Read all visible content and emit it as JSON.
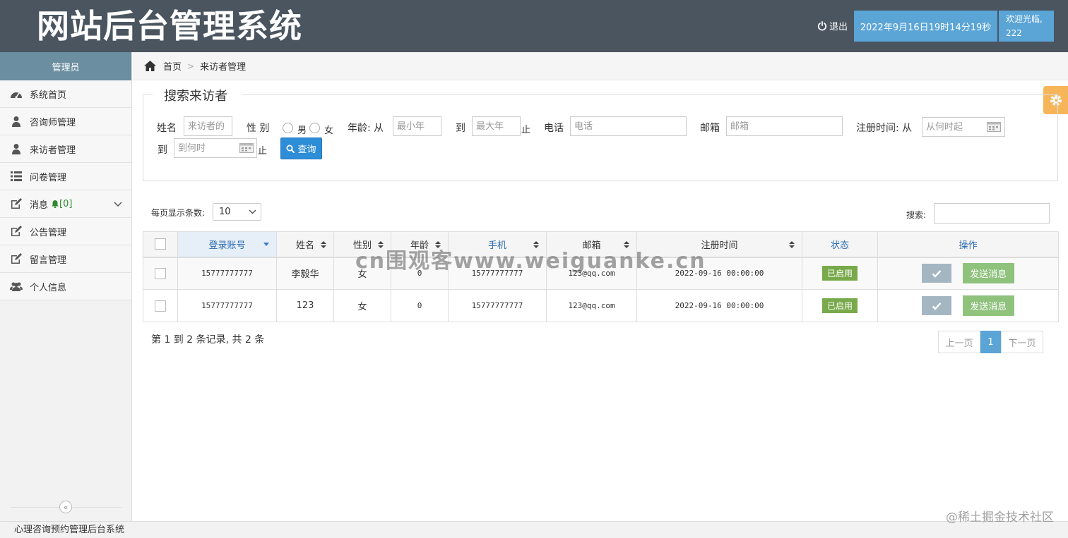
{
  "header": {
    "title": "网站后台管理系统",
    "logout_label": "退出",
    "datetime": "2022年9月16日19时14分19秒",
    "welcome_line1": "欢迎光临,",
    "welcome_line2": "222"
  },
  "sidebar": {
    "heading": "管理员",
    "items": [
      {
        "label": "系统首页",
        "icon": "dashboard-icon"
      },
      {
        "label": "咨询师管理",
        "icon": "user-icon"
      },
      {
        "label": "来访者管理",
        "icon": "user-icon"
      },
      {
        "label": "问卷管理",
        "icon": "list-icon"
      },
      {
        "label": "消息",
        "icon": "edit-icon",
        "count": "[0]"
      },
      {
        "label": "公告管理",
        "icon": "edit-icon"
      },
      {
        "label": "留言管理",
        "icon": "edit-icon"
      },
      {
        "label": "个人信息",
        "icon": "users-icon"
      }
    ],
    "collapse_glyph": "«"
  },
  "breadcrumb": {
    "home": "首页",
    "current": "来访者管理",
    "separator": ">"
  },
  "search": {
    "legend": "搜索来访者",
    "name_label": "姓名",
    "name_placeholder": "来访者的",
    "gender_label": "性 别",
    "gender_male": "男",
    "gender_female": "女",
    "age_label": "年龄: 从",
    "age_min_placeholder": "最小年",
    "age_to": "到",
    "age_max_placeholder": "最大年",
    "age_end": "止",
    "phone_label": "电话",
    "phone_placeholder": "电话",
    "email_label": "邮箱",
    "email_placeholder": "邮箱",
    "regtime_label": "注册时间: 从",
    "regtime_from_placeholder": "从何时起",
    "regtime_to": "到",
    "regtime_to_placeholder": "到何时",
    "regtime_end": "止",
    "query_label": "查询"
  },
  "table_controls": {
    "page_size_label": "每页显示条数:",
    "page_size_value": "10",
    "search_label": "搜索:"
  },
  "table": {
    "columns": [
      "登录账号",
      "姓名",
      "性别",
      "年龄",
      "手机",
      "邮箱",
      "注册时间",
      "状态",
      "操作"
    ],
    "rows": [
      {
        "account": "15777777777",
        "name": "李毅华",
        "gender": "女",
        "age": "0",
        "phone": "15777777777",
        "email": "123@qq.com",
        "regtime": "2022-09-16 00:00:00",
        "status": "已启用",
        "action": "发送消息"
      },
      {
        "account": "15777777777",
        "name": "123",
        "gender": "女",
        "age": "0",
        "phone": "15777777777",
        "email": "123@qq.com",
        "regtime": "2022-09-16 00:00:00",
        "status": "已启用",
        "action": "发送消息"
      }
    ]
  },
  "pagination": {
    "info": "第 1 到 2 条记录, 共 2 条",
    "prev": "上一页",
    "current": "1",
    "next": "下一页"
  },
  "watermark": "cn围观客www.weiguanke.cn",
  "footer": {
    "text": "心理咨询预约管理后台系统",
    "watermark": "@稀土掘金技术社区"
  },
  "colors": {
    "header_bg": "#4a5560",
    "accent_blue": "#5aa4d6",
    "query_button": "#2d8dd6",
    "status_green": "#78a94a",
    "send_green": "#8fc27d",
    "settings_orange": "#f7b55a"
  }
}
